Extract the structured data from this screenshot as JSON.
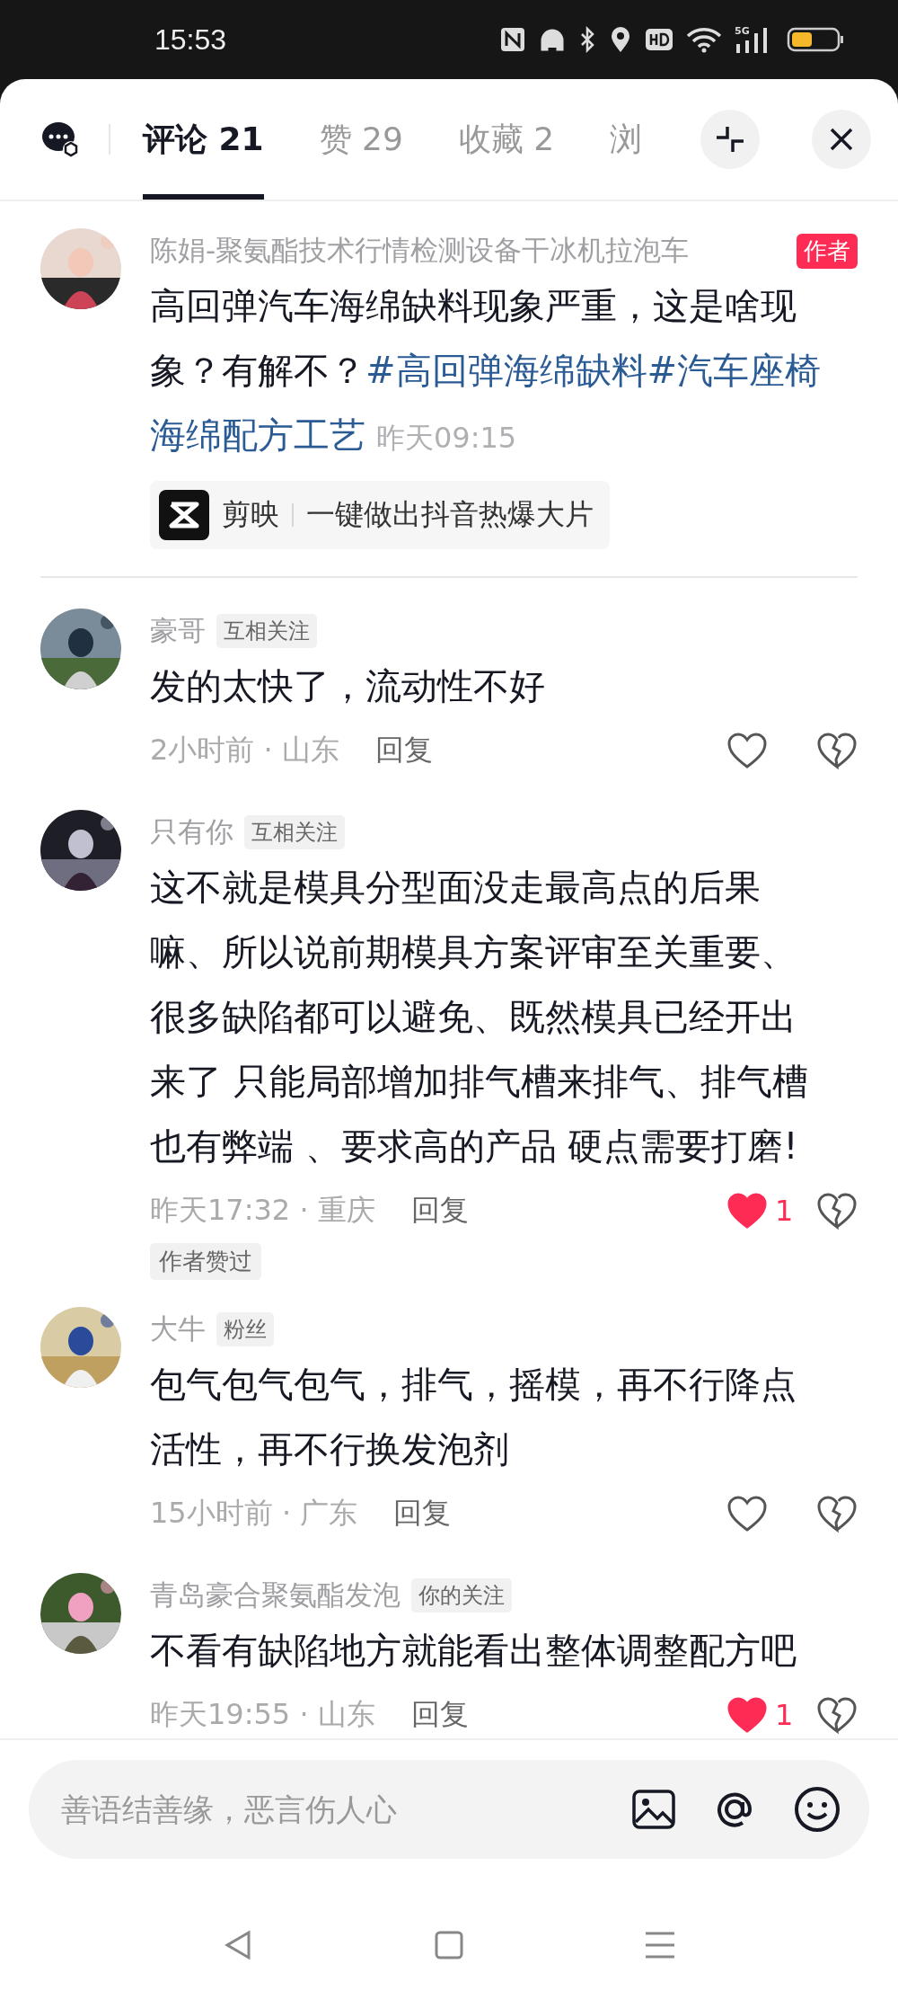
{
  "status_bar": {
    "time": "15:53",
    "network": "5G"
  },
  "tabs": [
    {
      "label": "评论 21",
      "selected": true
    },
    {
      "label": "赞 29",
      "selected": false
    },
    {
      "label": "收藏 2",
      "selected": false
    },
    {
      "label": "浏",
      "selected": false
    }
  ],
  "post": {
    "author": "陈娟-聚氨酯技术行情检测设备干冰机拉泡车",
    "badge": "作者",
    "segments": [
      {
        "kind": "text",
        "text": "高回弹汽车海绵缺料现象严重，这是啥现象？有解不？"
      },
      {
        "kind": "hashtag",
        "text": "#高回弹海绵缺料"
      },
      {
        "kind": "hashtag",
        "text": "#汽车座椅海绵配方工艺"
      }
    ],
    "time": "昨天09:15",
    "app_pill": {
      "app": "剪映",
      "slogan": "一键做出抖音热爆大片"
    }
  },
  "comments": [
    {
      "name": "豪哥",
      "tag": "互相关注",
      "text": "发的太快了，流动性不好",
      "meta": "2小时前 · 山东",
      "reply": "回复",
      "liked": false,
      "author_liked": false
    },
    {
      "name": "只有你",
      "tag": "互相关注",
      "text": "这不就是模具分型面没走最高点的后果嘛、所以说前期模具方案评审至关重要、很多缺陷都可以避免、既然模具已经开出来了 只能局部增加排气槽来排气、排气槽也有弊端 、要求高的产品 硬点需要打磨!",
      "meta": "昨天17:32 · 重庆",
      "reply": "回复",
      "liked": true,
      "likes": "1",
      "author_liked": true,
      "author_liked_label": "作者赞过"
    },
    {
      "name": "大牛",
      "tag": "粉丝",
      "text": "包气包气包气，排气，摇模，再不行降点活性，再不行换发泡剂",
      "meta": "15小时前 · 广东",
      "reply": "回复",
      "liked": false,
      "author_liked": false
    },
    {
      "name": "青岛豪合聚氨酯发泡",
      "tag": "你的关注",
      "text": "不看有缺陷地方就能看出整体调整配方吧",
      "meta": "昨天19:55 · 山东",
      "reply": "回复",
      "liked": true,
      "likes": "1",
      "author_liked": false
    }
  ],
  "input": {
    "placeholder": "善语结善缘，恶言伤人心"
  }
}
